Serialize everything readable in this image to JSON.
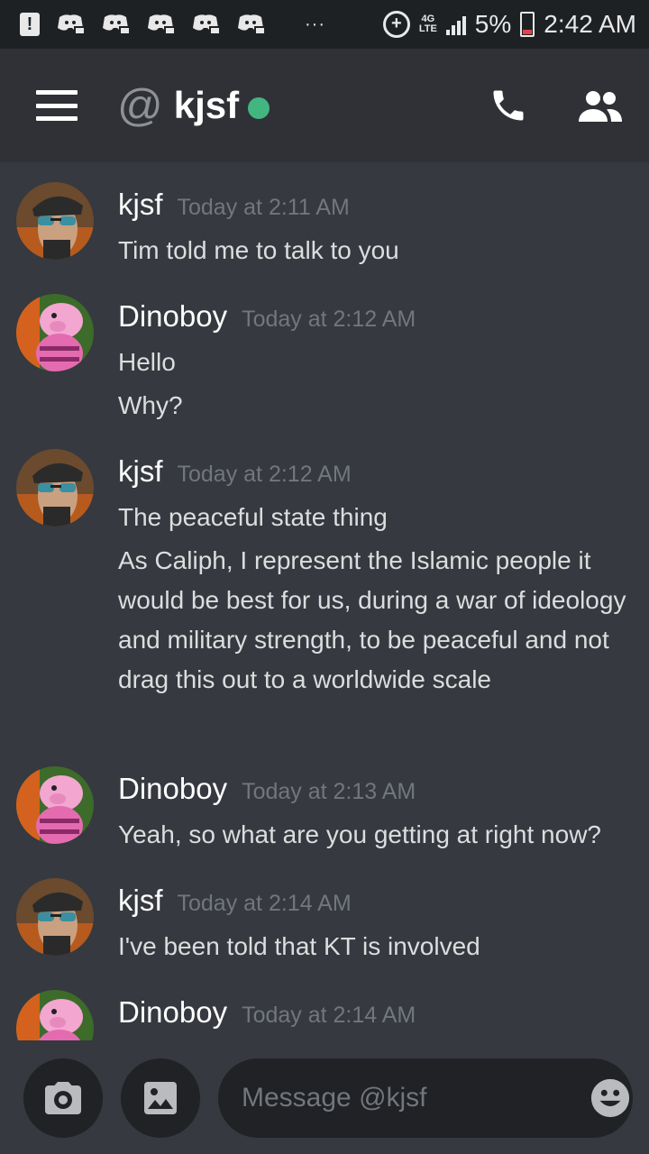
{
  "status_bar": {
    "more": "···",
    "data_icon": "+",
    "network": "4G",
    "network_sub": "LTE",
    "battery": "5%",
    "time": "2:42 AM"
  },
  "header": {
    "at_symbol": "@",
    "name": "kjsf",
    "status_color": "#43b581"
  },
  "messages": [
    {
      "author": "kjsf",
      "timestamp": "Today at 2:11 AM",
      "avatar": "kjsf-avatar",
      "lines": [
        "Tim told me to talk to you"
      ]
    },
    {
      "author": "Dinoboy",
      "timestamp": "Today at 2:12 AM",
      "avatar": "dinoboy-avatar",
      "lines": [
        "Hello",
        "Why?"
      ]
    },
    {
      "author": "kjsf",
      "timestamp": "Today at 2:12 AM",
      "avatar": "kjsf-avatar",
      "lines": [
        "The peaceful state thing",
        "As Caliph, I represent the Islamic people it would be best for us, during a war of ideology and military strength, to be peaceful and not drag this out to a worldwide scale"
      ]
    },
    {
      "author": "Dinoboy",
      "timestamp": "Today at 2:13 AM",
      "avatar": "dinoboy-avatar",
      "lines": [
        "Yeah, so what are you getting at right now?"
      ]
    },
    {
      "author": "kjsf",
      "timestamp": "Today at 2:14 AM",
      "avatar": "kjsf-avatar",
      "lines": [
        "I've been told that KT is involved"
      ]
    },
    {
      "author": "Dinoboy",
      "timestamp": "Today at 2:14 AM",
      "avatar": "dinoboy-avatar",
      "lines": []
    }
  ],
  "composer": {
    "placeholder": "Message @kjsf"
  },
  "colors": {
    "background": "#36393f",
    "header": "#2f3136",
    "online": "#43b581",
    "accent": "#7289da"
  }
}
